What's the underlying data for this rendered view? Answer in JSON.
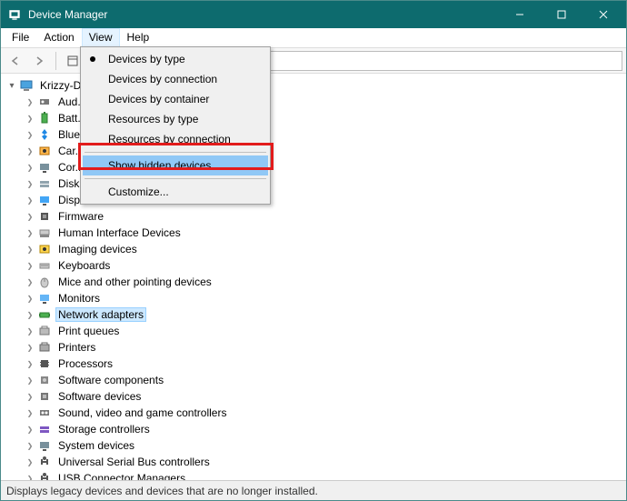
{
  "window": {
    "title": "Device Manager"
  },
  "menubar": {
    "file": "File",
    "action": "Action",
    "view": "View",
    "help": "Help"
  },
  "viewMenu": {
    "byType": "Devices by type",
    "byConn": "Devices by connection",
    "byCont": "Devices by container",
    "resType": "Resources by type",
    "resConn": "Resources by connection",
    "showHidden": "Show hidden devices",
    "customize": "Customize..."
  },
  "tree": {
    "root": "Krizzy-D...",
    "items": [
      "Aud...",
      "Batt...",
      "Blue...",
      "Car...",
      "Cor...",
      "Disk...",
      "Disp...",
      "Firmware",
      "Human Interface Devices",
      "Imaging devices",
      "Keyboards",
      "Mice and other pointing devices",
      "Monitors",
      "Network adapters",
      "Print queues",
      "Printers",
      "Processors",
      "Software components",
      "Software devices",
      "Sound, video and game controllers",
      "Storage controllers",
      "System devices",
      "Universal Serial Bus controllers",
      "USB Connector Managers"
    ],
    "selectedIndex": 13
  },
  "status": "Displays legacy devices and devices that are no longer installed."
}
